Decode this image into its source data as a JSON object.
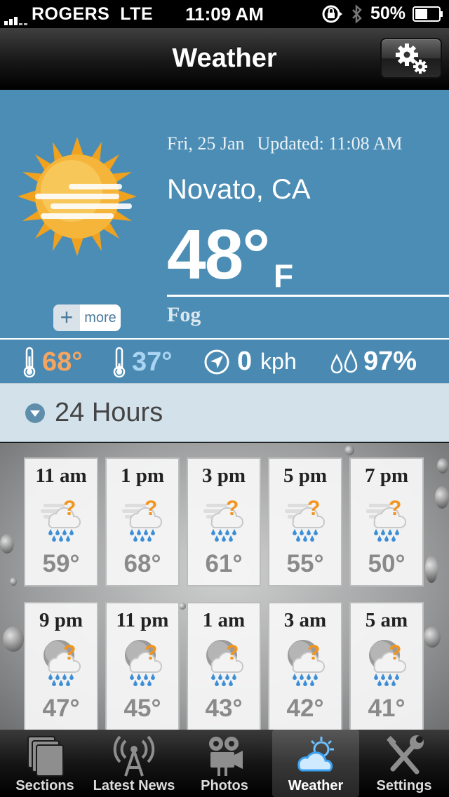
{
  "status_bar": {
    "carrier": "ROGERS",
    "network": "LTE",
    "time": "11:09 AM",
    "battery": "50%"
  },
  "nav": {
    "title": "Weather",
    "settings_icon": "gears-icon"
  },
  "current": {
    "date": "Fri, 25 Jan",
    "updated": "Updated: 11:08 AM",
    "city": "Novato, CA",
    "temp": "48°",
    "unit": "F",
    "condition": "Fog",
    "more_label": "more",
    "icon": "sun-fog-icon"
  },
  "stats": {
    "high": "68°",
    "low": "37°",
    "wind": "0",
    "wind_unit": "kph",
    "humidity": "97%",
    "high_color": "#f5a560",
    "low_color": "#a9d4f2"
  },
  "hours_header": {
    "label": "24 Hours"
  },
  "forecast": [
    {
      "time": "11 am",
      "temp": "59°"
    },
    {
      "time": "1 pm",
      "temp": "68°"
    },
    {
      "time": "3 pm",
      "temp": "61°"
    },
    {
      "time": "5 pm",
      "temp": "55°"
    },
    {
      "time": "7 pm",
      "temp": "50°"
    },
    {
      "time": "9 pm",
      "temp": "47°"
    },
    {
      "time": "11 pm",
      "temp": "45°"
    },
    {
      "time": "1 am",
      "temp": "43°"
    },
    {
      "time": "3 am",
      "temp": "42°"
    },
    {
      "time": "5 am",
      "temp": "41°"
    }
  ],
  "tabs": [
    {
      "label": "Sections",
      "icon": "sections-icon"
    },
    {
      "label": "Latest News",
      "icon": "broadcast-tower-icon"
    },
    {
      "label": "Photos",
      "icon": "camera-icon"
    },
    {
      "label": "Weather",
      "icon": "weather-icon",
      "active": true
    },
    {
      "label": "Settings",
      "icon": "tools-icon"
    }
  ]
}
